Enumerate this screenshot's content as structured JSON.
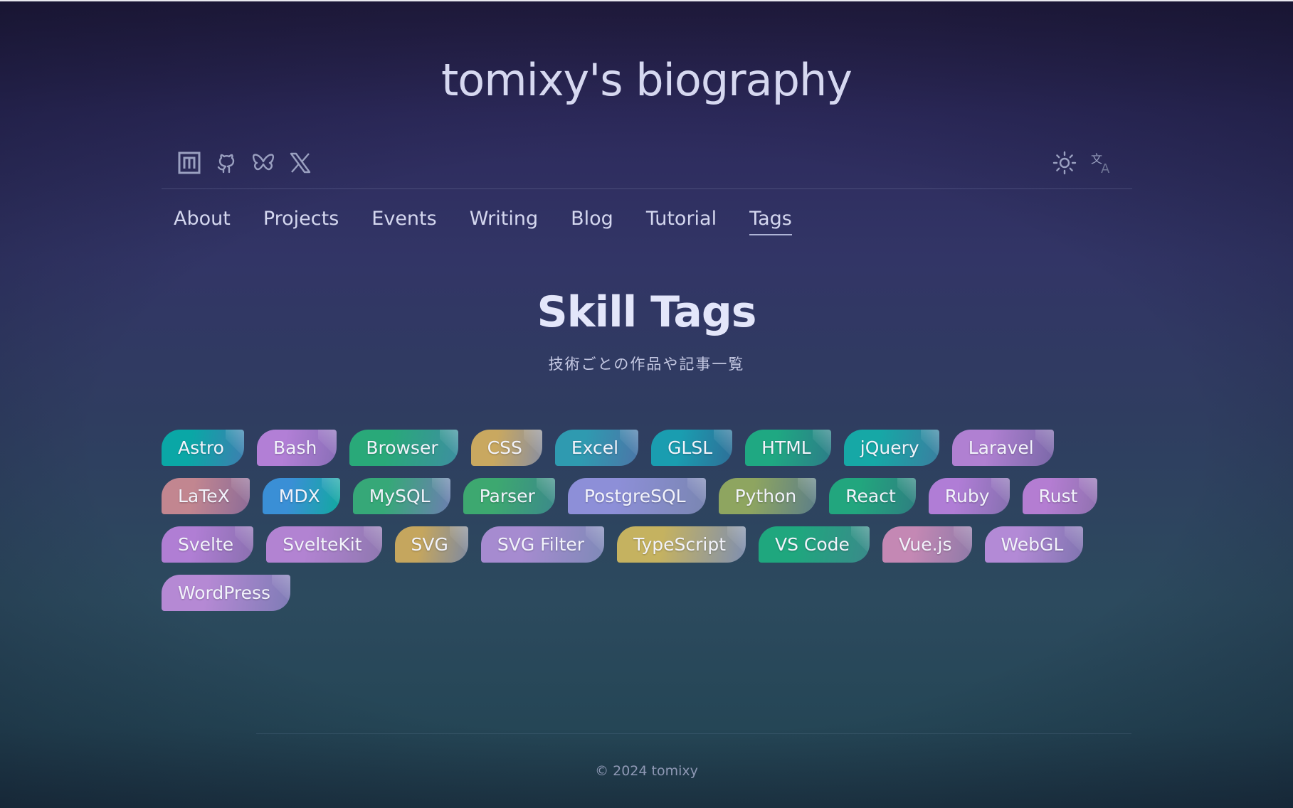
{
  "site": {
    "title": "tomixy's biography"
  },
  "social_icons": [
    {
      "name": "note-icon"
    },
    {
      "name": "github-icon"
    },
    {
      "name": "bluesky-icon"
    },
    {
      "name": "x-icon"
    }
  ],
  "prefs": [
    {
      "name": "theme-toggle-icon"
    },
    {
      "name": "translate-icon"
    }
  ],
  "nav": {
    "items": [
      {
        "label": "About",
        "active": false
      },
      {
        "label": "Projects",
        "active": false
      },
      {
        "label": "Events",
        "active": false
      },
      {
        "label": "Writing",
        "active": false
      },
      {
        "label": "Blog",
        "active": false
      },
      {
        "label": "Tutorial",
        "active": false
      },
      {
        "label": "Tags",
        "active": true
      }
    ]
  },
  "page": {
    "title": "Skill Tags",
    "subtitle": "技術ごとの作品や記事一覧"
  },
  "tags": [
    {
      "label": "Astro",
      "colors": [
        "#0aa7a6",
        "#3d7fb0"
      ]
    },
    {
      "label": "Bash",
      "colors": [
        "#b27fd6",
        "#8a6fb8"
      ]
    },
    {
      "label": "Browser",
      "colors": [
        "#29a979",
        "#3d8fa0"
      ]
    },
    {
      "label": "CSS",
      "colors": [
        "#c9a860",
        "#8a8fa0"
      ]
    },
    {
      "label": "Excel",
      "colors": [
        "#2f9ab0",
        "#4b76a8"
      ]
    },
    {
      "label": "GLSL",
      "colors": [
        "#1a9db0",
        "#2e6f98"
      ]
    },
    {
      "label": "HTML",
      "colors": [
        "#1fa882",
        "#2c7d88"
      ]
    },
    {
      "label": "jQuery",
      "colors": [
        "#16a8a6",
        "#3a7fa0"
      ]
    },
    {
      "label": "Laravel",
      "colors": [
        "#b080d2",
        "#7a68a8"
      ]
    },
    {
      "label": "LaTeX",
      "colors": [
        "#c28690",
        "#8d6c98"
      ]
    },
    {
      "label": "MDX",
      "colors": [
        "#3a8fd6",
        "#12a9a0"
      ]
    },
    {
      "label": "MySQL",
      "colors": [
        "#36a878",
        "#6c7fb0"
      ]
    },
    {
      "label": "Parser",
      "colors": [
        "#3da870",
        "#3c8a8a"
      ]
    },
    {
      "label": "PostgreSQL",
      "colors": [
        "#8d8fd8",
        "#7a86b2"
      ]
    },
    {
      "label": "Python",
      "colors": [
        "#8ea560",
        "#5d7f88"
      ]
    },
    {
      "label": "React",
      "colors": [
        "#22a67e",
        "#2e7f80"
      ]
    },
    {
      "label": "Ruby",
      "colors": [
        "#b07dd6",
        "#8670b0"
      ]
    },
    {
      "label": "Rust",
      "colors": [
        "#b47dd2",
        "#9072b0"
      ]
    },
    {
      "label": "Svelte",
      "colors": [
        "#b07ed4",
        "#8a70b0"
      ]
    },
    {
      "label": "SvelteKit",
      "colors": [
        "#b283d2",
        "#8f78b0"
      ]
    },
    {
      "label": "SVG",
      "colors": [
        "#c5a65e",
        "#7f8aa0"
      ]
    },
    {
      "label": "SVG Filter",
      "colors": [
        "#a68bd0",
        "#7f8ab8"
      ]
    },
    {
      "label": "TypeScript",
      "colors": [
        "#c5b260",
        "#7f8fb0"
      ]
    },
    {
      "label": "VS Code",
      "colors": [
        "#1fa77e",
        "#3a8a8a"
      ]
    },
    {
      "label": "Vue.js",
      "colors": [
        "#c488b4",
        "#8f7aa8"
      ]
    },
    {
      "label": "WebGL",
      "colors": [
        "#b38ad6",
        "#8074b0"
      ]
    },
    {
      "label": "WordPress",
      "colors": [
        "#b589d4",
        "#7f7cb6"
      ]
    }
  ],
  "footer": {
    "text": "© 2024 tomixy"
  }
}
